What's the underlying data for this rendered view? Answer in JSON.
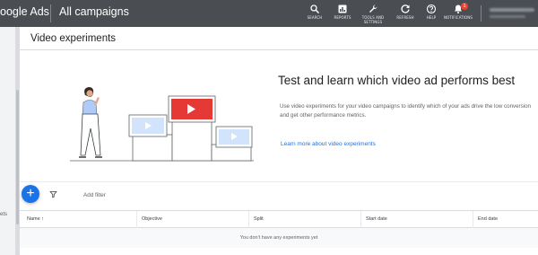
{
  "topbar": {
    "brand": "oogle Ads",
    "title": "All campaigns",
    "tools": [
      {
        "label": "SEARCH",
        "icon": "search-icon"
      },
      {
        "label": "REPORTS",
        "icon": "reports-icon"
      },
      {
        "label": "TOOLS AND SETTINGS",
        "icon": "wrench-icon"
      },
      {
        "label": "REFRESH",
        "icon": "refresh-icon"
      },
      {
        "label": "HELP",
        "icon": "help-icon"
      },
      {
        "label": "NOTIFICATIONS",
        "icon": "bell-icon",
        "badge": "1"
      }
    ]
  },
  "leftrail": {
    "partial_text": "ets"
  },
  "page": {
    "title": "Video experiments"
  },
  "hero": {
    "title": "Test and learn which video ad performs best",
    "body": "Use video experiments for your video campaigns to identify which of your ads drive the low conversion and get other performance metrics.",
    "link": "Learn more about video experiments"
  },
  "toolbar": {
    "add_label": "+",
    "filter_label": "Add filter"
  },
  "table": {
    "columns": [
      "Name",
      "Objective",
      "Split",
      "Start date",
      "End date"
    ],
    "sort_indicator": "↑",
    "empty_message": "You don't have any experiments yet"
  },
  "colors": {
    "brand_blue": "#1a73e8",
    "topbar": "#4a4e53",
    "youtube_red": "#e53935",
    "notif_red": "#ea4335"
  }
}
